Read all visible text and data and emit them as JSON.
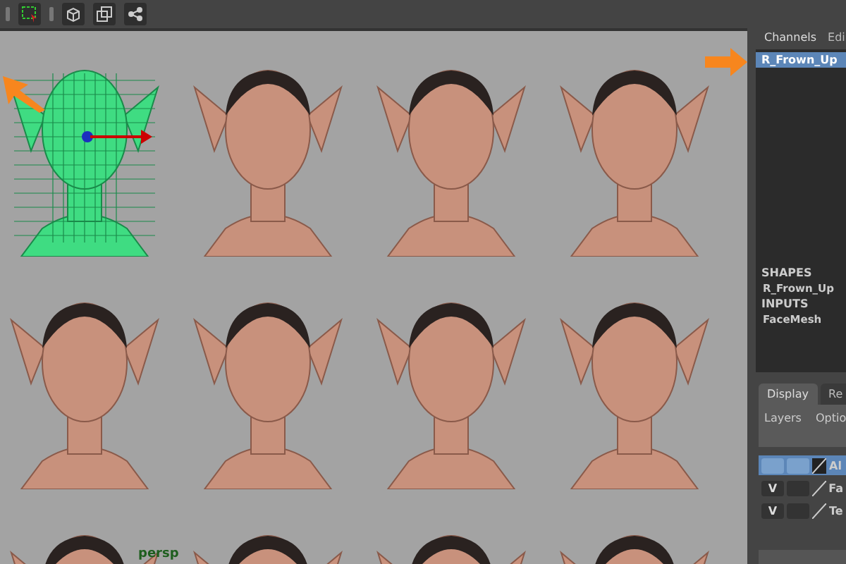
{
  "viewport": {
    "camera_label": "persp",
    "heads": [
      {
        "kind": "wireframe"
      },
      {
        "kind": "shaded"
      },
      {
        "kind": "shaded"
      },
      {
        "kind": "shaded"
      },
      {
        "kind": "shaded"
      },
      {
        "kind": "shaded"
      },
      {
        "kind": "shaded"
      },
      {
        "kind": "shaded"
      },
      {
        "kind": "shaded"
      },
      {
        "kind": "shaded"
      },
      {
        "kind": "shaded"
      },
      {
        "kind": "shaded"
      }
    ]
  },
  "channel_box": {
    "tabs": [
      {
        "label": "Channels",
        "selected": true
      },
      {
        "label": "Edi",
        "selected": false
      }
    ],
    "objects": [
      {
        "label": "R_Frown_Up",
        "selected": true
      }
    ],
    "sections": [
      {
        "heading": "SHAPES",
        "items": [
          "R_Frown_Up"
        ]
      },
      {
        "heading": "INPUTS",
        "items": [
          "FaceMesh"
        ]
      }
    ]
  },
  "layer_editor": {
    "tabs": [
      {
        "label": "Display",
        "selected": true
      },
      {
        "label": "Re",
        "selected": false
      }
    ],
    "menu": [
      "Layers",
      "Optio"
    ],
    "layers": [
      {
        "label": "Al",
        "selected": true
      },
      {
        "label": "Fa",
        "visibility_label": "V",
        "selected": false
      },
      {
        "label": "Te",
        "visibility_label": "V",
        "selected": false
      }
    ]
  }
}
